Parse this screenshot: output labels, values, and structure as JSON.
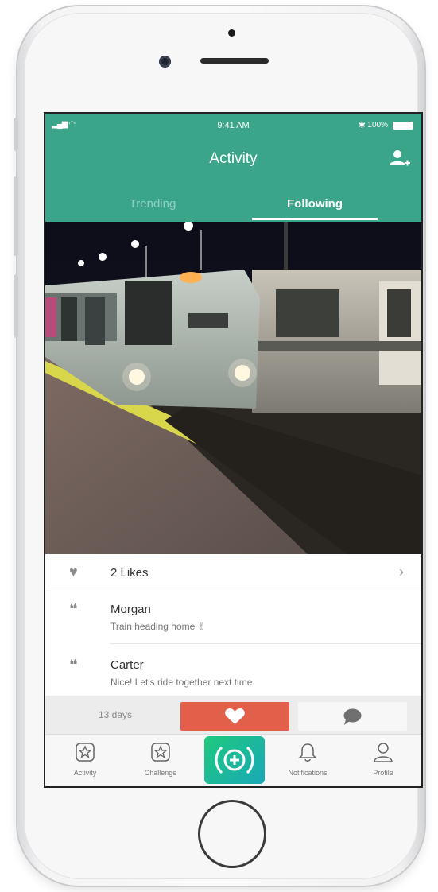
{
  "status_bar": {
    "time": "9:41 AM",
    "battery": "100%",
    "bluetooth": "✱"
  },
  "header": {
    "title": "Activity",
    "add_user_icon": "add-user-icon"
  },
  "tabs": [
    {
      "label": "Trending",
      "selected": false
    },
    {
      "label": "Following",
      "selected": true
    }
  ],
  "post": {
    "likes_label": "2 Likes",
    "comments": [
      {
        "author": "Morgan",
        "text": "Train heading home ✌"
      },
      {
        "author": "Carter",
        "text": "Nice! Let's ride together next time"
      }
    ],
    "age": "13 days"
  },
  "tab_bar": [
    {
      "label": "Activity",
      "icon": "star-badge-icon"
    },
    {
      "label": "Challenge",
      "icon": "star-badge-icon"
    },
    {
      "label": "",
      "icon": "plus-broadcast-icon"
    },
    {
      "label": "Notifications",
      "icon": "bell-icon"
    },
    {
      "label": "Profile",
      "icon": "person-icon"
    }
  ],
  "colors": {
    "brand": "#3aa589",
    "like": "#e2604a",
    "center_button": "#1ec97c"
  }
}
